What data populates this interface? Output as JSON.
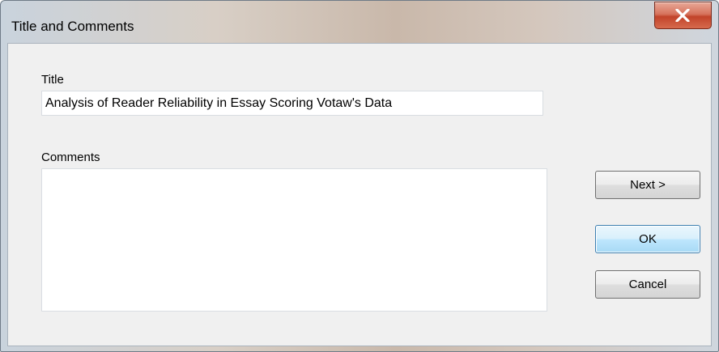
{
  "window": {
    "title": "Title and Comments",
    "close_icon": "close-x-icon"
  },
  "form": {
    "title_label": "Title",
    "title_value": "Analysis of Reader Reliability in Essay Scoring Votaw's Data",
    "comments_label": "Comments",
    "comments_value": ""
  },
  "buttons": {
    "next_label": "Next >",
    "ok_label": "OK",
    "cancel_label": "Cancel"
  },
  "colors": {
    "close_button": "#c2432a",
    "default_button_border": "#3c7fb1",
    "dialog_background": "#f0f0f0"
  }
}
